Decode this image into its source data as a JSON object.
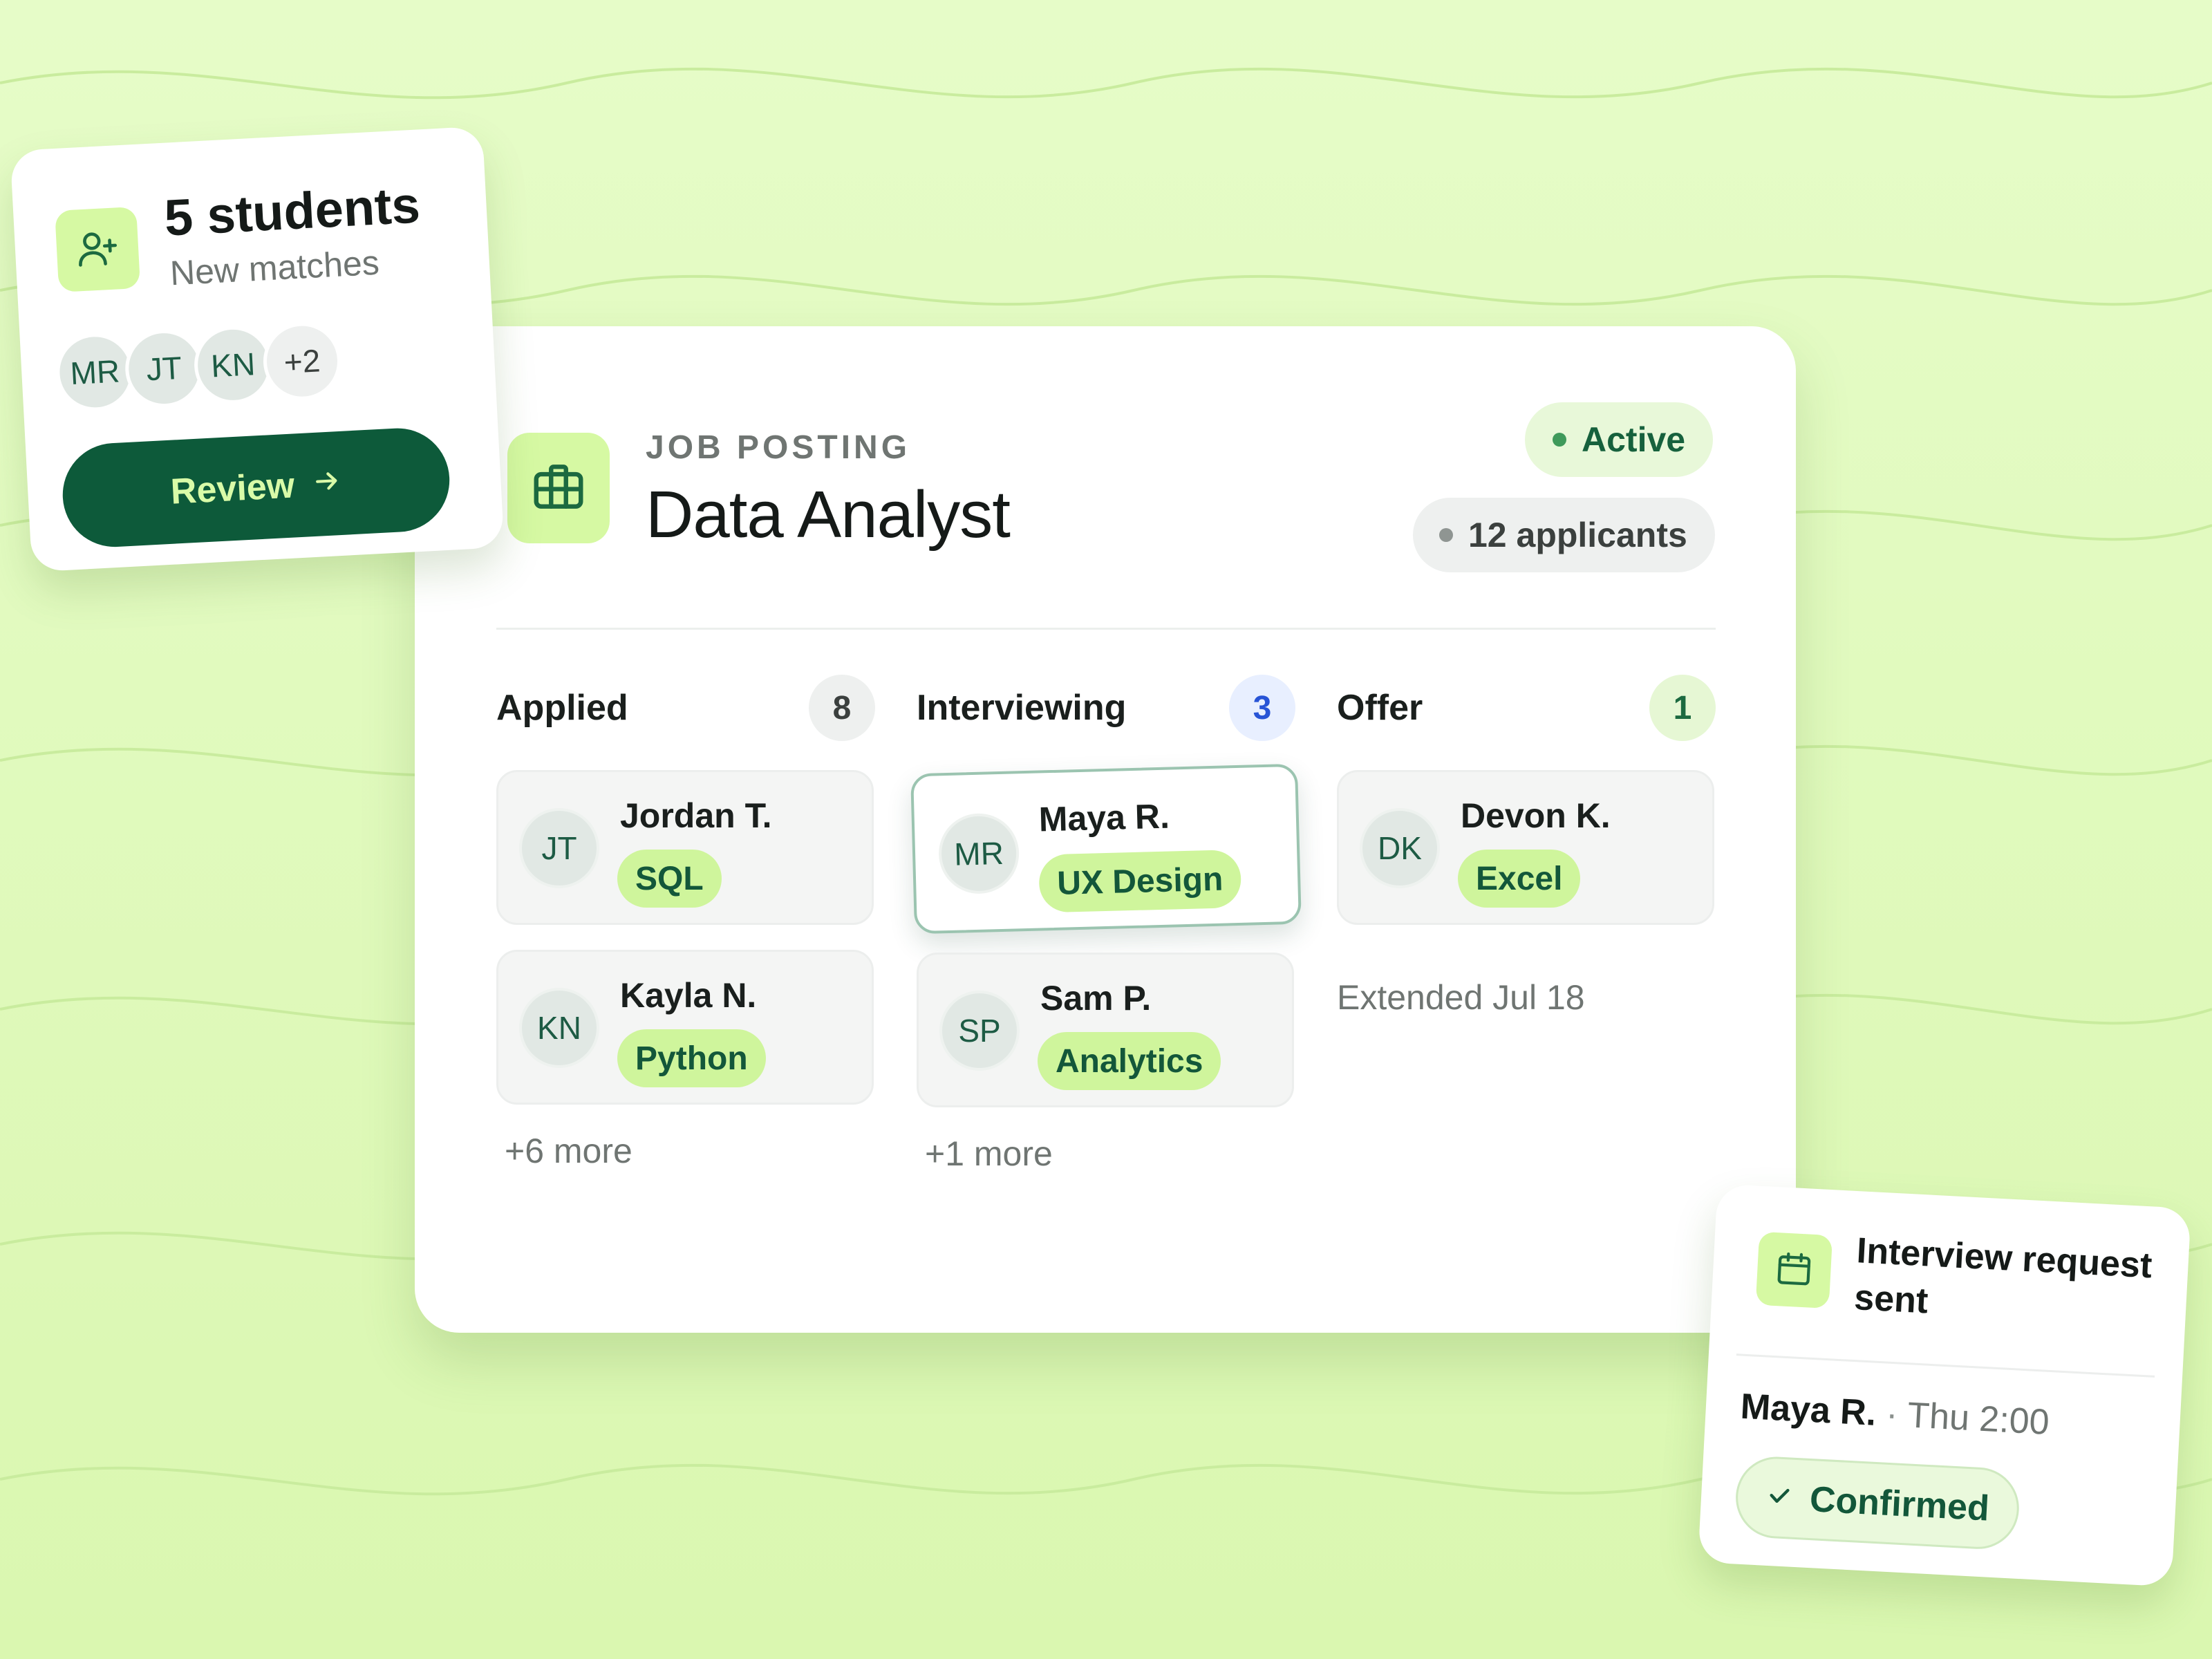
{
  "job": {
    "label": "JOB POSTING",
    "title": "Data Analyst",
    "status": "Active",
    "applicants": "12 applicants",
    "icon": "briefcase-icon"
  },
  "columns": [
    {
      "title": "Applied",
      "count": "8",
      "candidates": [
        {
          "initials": "JT",
          "name": "Jordan T.",
          "skill": "SQL"
        },
        {
          "initials": "KN",
          "name": "Kayla N.",
          "skill": "Python"
        }
      ],
      "footer": "+6 more"
    },
    {
      "title": "Interviewing",
      "count": "3",
      "candidates": [
        {
          "initials": "MR",
          "name": "Maya R.",
          "skill": "UX Design"
        },
        {
          "initials": "SP",
          "name": "Sam P.",
          "skill": "Analytics"
        }
      ],
      "footer": "+1 more"
    },
    {
      "title": "Offer",
      "count": "1",
      "candidates": [
        {
          "initials": "DK",
          "name": "Devon K.",
          "skill": "Excel"
        }
      ],
      "footer": "Extended Jul 18"
    }
  ],
  "students": {
    "count": "5 students",
    "subtitle": "New matches",
    "avatars": [
      "MR",
      "JT",
      "KN"
    ],
    "extra": "+2",
    "button": "Review",
    "icon": "user-plus-icon"
  },
  "interview": {
    "title": "Interview request sent",
    "name": "Maya R.",
    "separator": "·",
    "time": "Thu 2:00",
    "status": "Confirmed",
    "icon": "calendar-icon"
  },
  "colors": {
    "background": "#dff9bb",
    "accent": "#d6f9a3",
    "brand_dark": "#0d5a3a",
    "tag": "#cff59c",
    "interviewing_count": "#2854d6"
  }
}
